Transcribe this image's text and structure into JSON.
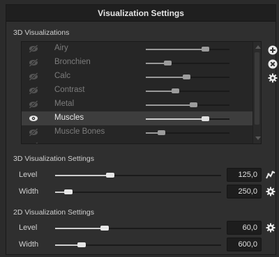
{
  "panel": {
    "title": "Visualization Settings"
  },
  "viz3d_list": {
    "section_label": "3D Visualizations",
    "items": [
      {
        "label": "Airy",
        "visible": false,
        "selected": false,
        "level": 0.71
      },
      {
        "label": "Bronchien",
        "visible": false,
        "selected": false,
        "level": 0.26
      },
      {
        "label": "Calc",
        "visible": false,
        "selected": false,
        "level": 0.48
      },
      {
        "label": "Contrast",
        "visible": false,
        "selected": false,
        "level": 0.35
      },
      {
        "label": "Metal",
        "visible": false,
        "selected": false,
        "level": 0.57
      },
      {
        "label": "Muscles",
        "visible": true,
        "selected": true,
        "level": 0.71
      },
      {
        "label": "Muscle Bones",
        "visible": false,
        "selected": false,
        "level": 0.18
      },
      {
        "label": "",
        "visible": false,
        "selected": false,
        "level": 0.0
      }
    ],
    "actions": {
      "add_icon": "plus-circle-icon",
      "remove_icon": "x-circle-icon",
      "settings_icon": "gear-icon"
    }
  },
  "viz3d_settings": {
    "section_label": "3D Visualization Settings",
    "level": {
      "label": "Level",
      "value": "125,0",
      "fraction": 0.33,
      "icon": "curve-icon"
    },
    "width": {
      "label": "Width",
      "value": "250,0",
      "fraction": 0.08,
      "icon": "gear-icon"
    }
  },
  "viz2d_settings": {
    "section_label": "2D Visualization Settings",
    "level": {
      "label": "Level",
      "value": "60,0",
      "fraction": 0.3,
      "icon": "gear-icon"
    },
    "width": {
      "label": "Width",
      "value": "600,0",
      "fraction": 0.16
    }
  }
}
